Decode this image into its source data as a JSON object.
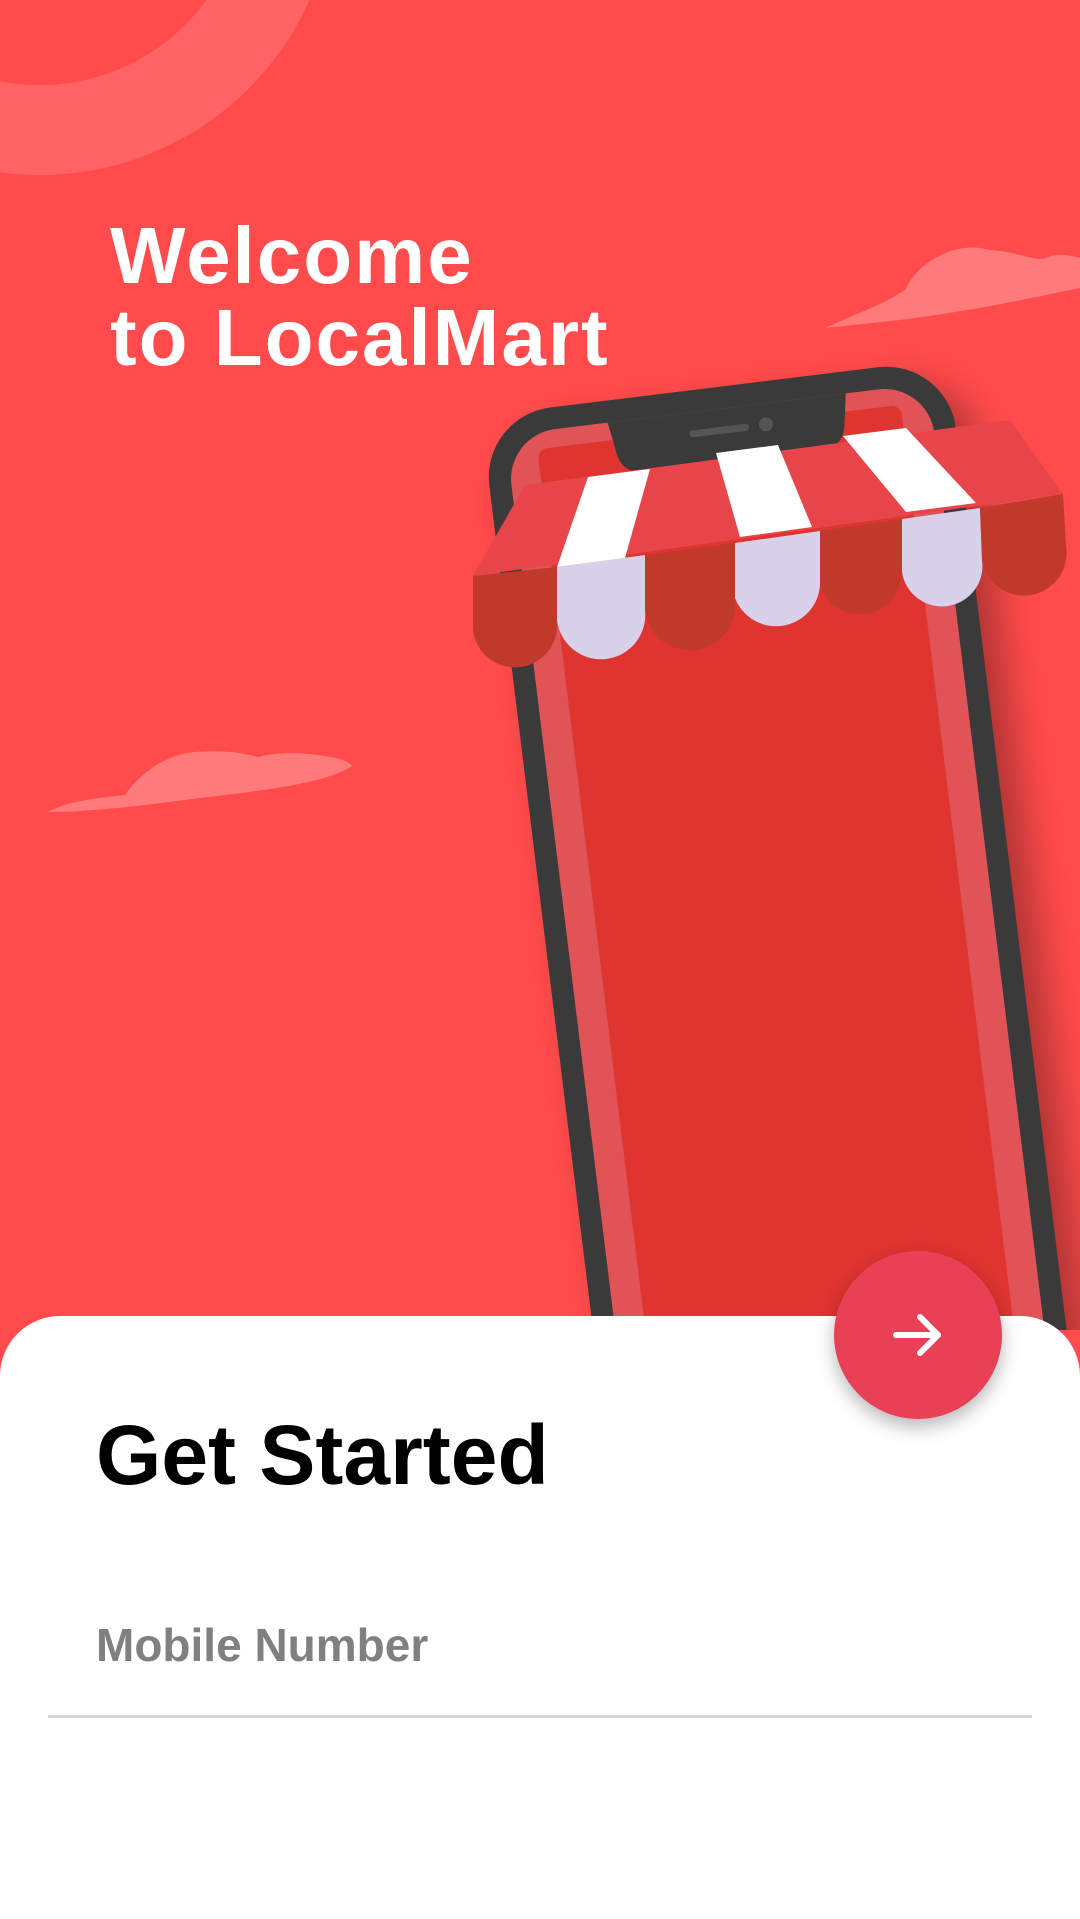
{
  "app": {
    "welcome_line1": "Welcome",
    "welcome_line2": "to LocalMart"
  },
  "illustration": {
    "name": "phone-storefront-illustration",
    "colors": {
      "background": "#FF4B4B",
      "phone_body": "#3A3A3A",
      "phone_screen": "#DF3430",
      "awning_red": "#E8454A",
      "awning_white": "#FFFFFF",
      "awning_scallop_light": "#D9D0EA",
      "awning_scallop_dark": "#C0392B",
      "cloud": "#FF7B7B"
    }
  },
  "form": {
    "title": "Get Started",
    "mobile_placeholder": "Mobile Number",
    "mobile_value": ""
  },
  "next_button": {
    "icon": "arrow-right-icon",
    "color": "#E84155"
  }
}
